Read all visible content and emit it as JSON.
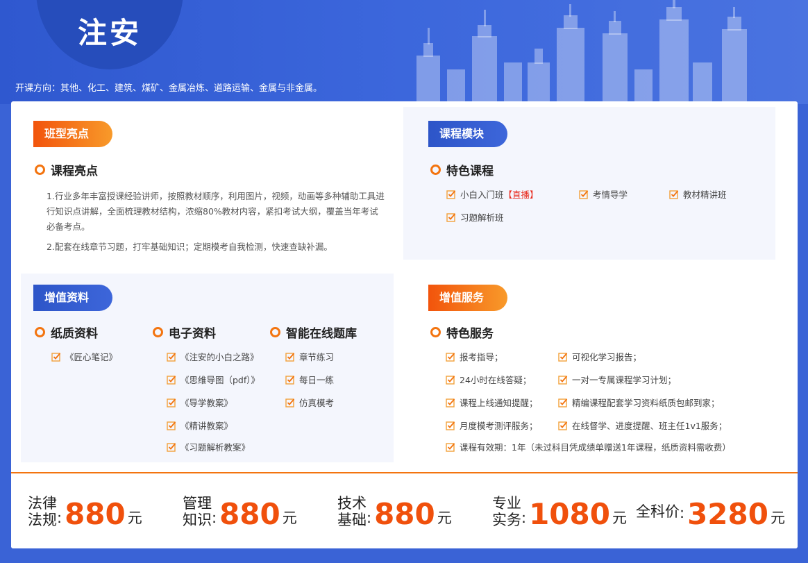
{
  "header": {
    "title": "注安",
    "directions": "开课方向：其他、化工、建筑、煤矿、金属冶炼、道路运输、金属与非金属。"
  },
  "highlights": {
    "tag": "班型亮点",
    "heading": "课程亮点",
    "para1": "1.行业多年丰富授课经验讲师，按照教材顺序，利用图片，视频，动画等多种辅助工具进行知识点讲解，全面梳理教材结构，浓缩80%教材内容，紧扣考试大纲，覆盖当年考试必备考点。",
    "para2": "2.配套在线章节习题，打牢基础知识；定期模考自我检测，快速查缺补漏。"
  },
  "modules": {
    "tag": "课程模块",
    "heading": "特色课程",
    "items": [
      "小白入门班",
      "考情导学",
      "教材精讲班",
      "习题解析班"
    ],
    "live_badge": "【直播】"
  },
  "materials": {
    "tag": "增值资料",
    "paper": {
      "heading": "纸质资料",
      "items": [
        "《匠心笔记》"
      ]
    },
    "digital": {
      "heading": "电子资料",
      "items": [
        "《注安的小白之路》",
        "《思维导图（pdf）》",
        "《导学教案》",
        "《精讲教案》",
        "《习题解析教案》"
      ]
    },
    "bank": {
      "heading": "智能在线题库",
      "items": [
        "章节练习",
        "每日一练",
        "仿真模考"
      ]
    }
  },
  "services": {
    "tag": "增值服务",
    "heading": "特色服务",
    "left": [
      "报考指导；",
      "24小时在线答疑；",
      "课程上线通知提醒；",
      "月度模考测评服务；"
    ],
    "right": [
      "可视化学习报告；",
      "一对一专属课程学习计划；",
      "精编课程配套学习资料纸质包邮到家；",
      "在线督学、进度提醒、班主任1v1服务；"
    ],
    "last": "课程有效期：1年（未过科目凭成绩单赠送1年课程，纸质资料需收费）"
  },
  "prices": [
    {
      "label1": "法律",
      "label2": "法规",
      "value": "880",
      "unit": "元"
    },
    {
      "label1": "管理",
      "label2": "知识",
      "value": "880",
      "unit": "元"
    },
    {
      "label1": "技术",
      "label2": "基础",
      "value": "880",
      "unit": "元"
    },
    {
      "label1": "专业",
      "label2": "实务",
      "value": "1080",
      "unit": "元"
    }
  ],
  "total": {
    "label": "全科价",
    "value": "3280",
    "unit": "元"
  },
  "colors": {
    "accent": "#f3740f",
    "brand_blue": "#3a63d6",
    "price": "#f0500c"
  }
}
